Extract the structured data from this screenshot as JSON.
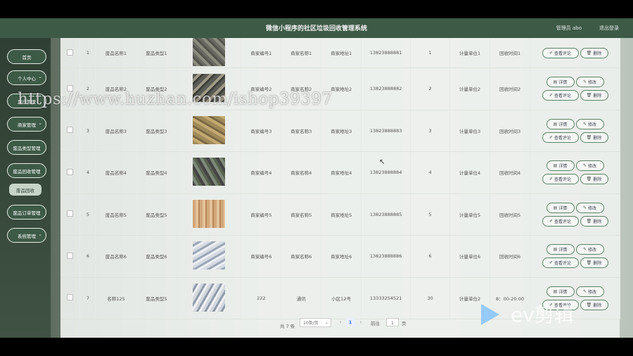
{
  "header": {
    "title": "微信小程序的社区垃圾回收管理系统",
    "user": "管理员 abo",
    "logout": "退出登录"
  },
  "sidebar": {
    "items": [
      {
        "label": "首页"
      },
      {
        "label": "个人中心"
      },
      {
        "label": "用户管理"
      },
      {
        "label": "商家管理"
      },
      {
        "label": "废品类型管理"
      },
      {
        "label": "废品回收管理"
      },
      {
        "label": "废品订单管理"
      },
      {
        "label": "系统管理"
      }
    ],
    "active_sub": "废品回收"
  },
  "rows": [
    {
      "index": "1",
      "name": "废品名称1",
      "type": "废品类型1",
      "merchant_no": "商家编号1",
      "merchant_name": "商家名称1",
      "address": "商家地址1",
      "phone": "13823888881",
      "qty": "1",
      "unit": "计量单位1",
      "time": "回收时间1"
    },
    {
      "index": "2",
      "name": "废品名称2",
      "type": "废品类型2",
      "merchant_no": "商家编号2",
      "merchant_name": "商家名称2",
      "address": "商家地址2",
      "phone": "13823888882",
      "qty": "2",
      "unit": "计量单位2",
      "time": "回收时间2"
    },
    {
      "index": "3",
      "name": "废品名称3",
      "type": "废品类型3",
      "merchant_no": "商家编号3",
      "merchant_name": "商家名称3",
      "address": "商家地址3",
      "phone": "13823888883",
      "qty": "3",
      "unit": "计量单位3",
      "time": "回收时间3"
    },
    {
      "index": "4",
      "name": "废品名称4",
      "type": "废品类型4",
      "merchant_no": "商家编号4",
      "merchant_name": "商家名称4",
      "address": "商家地址4",
      "phone": "13823888884",
      "qty": "4",
      "unit": "计量单位4",
      "time": "回收时间4"
    },
    {
      "index": "5",
      "name": "废品名称5",
      "type": "废品类型5",
      "merchant_no": "商家编号5",
      "merchant_name": "商家名称5",
      "address": "商家地址5",
      "phone": "13823888885",
      "qty": "5",
      "unit": "计量单位5",
      "time": "回收时间5"
    },
    {
      "index": "6",
      "name": "废品名称6",
      "type": "废品类型6",
      "merchant_no": "商家编号6",
      "merchant_name": "商家名称6",
      "address": "商家地址6",
      "phone": "13823888886",
      "qty": "6",
      "unit": "计量单位6",
      "time": "回收时间6"
    },
    {
      "index": "7",
      "name": "名称125",
      "type": "废品类型5",
      "merchant_no": "222",
      "merchant_name": "通讯",
      "address": "小区12号",
      "phone": "13333254521",
      "qty": "30",
      "unit": "计量单位2",
      "time": "8：00-20:00"
    }
  ],
  "actions": {
    "detail": "详情",
    "edit": "修改",
    "review": "查看评论",
    "delete": "删除"
  },
  "pager": {
    "total": "共 7 条",
    "page_size": "10条/页",
    "current": "1",
    "goto_label": "前往",
    "goto_value": "1",
    "page_suffix": "页"
  },
  "overlays": {
    "watermark": "https://www.huzhan.com/ishop39397",
    "editor_logo": "ev剪辑"
  }
}
